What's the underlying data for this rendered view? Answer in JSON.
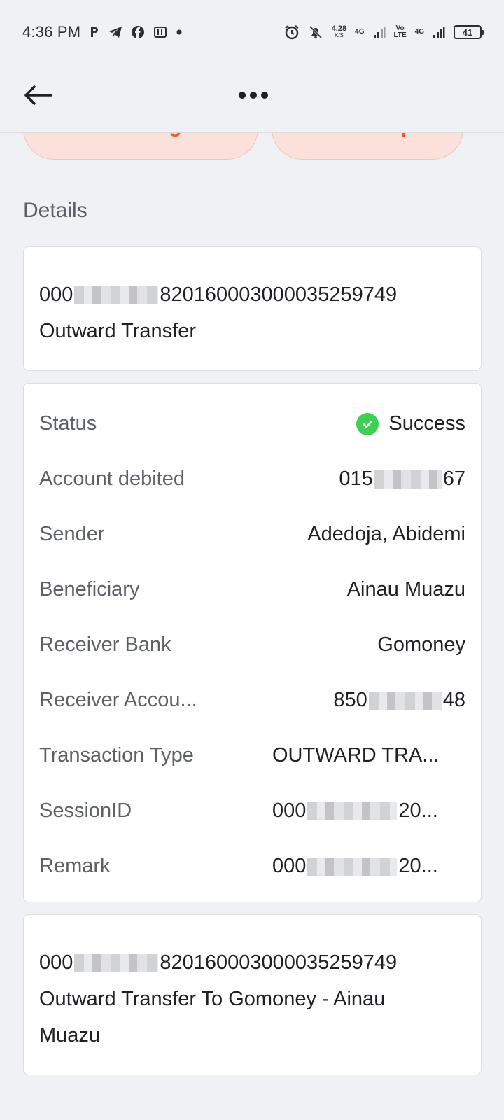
{
  "status_bar": {
    "time": "4:36 PM",
    "speed_value": "4.28",
    "speed_unit": "K/S",
    "net1": "4G",
    "volte_top": "Vo",
    "volte_bottom": "LTE",
    "net2": "4G",
    "battery": "41"
  },
  "app_bar": {
    "back_icon": "arrow-left-icon",
    "more_icon": "more-horizontal-icon"
  },
  "actions": {
    "send_again": "Send again",
    "receipt": "Receipt"
  },
  "section_title": "Details",
  "reference_card": {
    "ref_prefix": "000",
    "ref_suffix": "820160003000035259749",
    "type": "Outward Transfer"
  },
  "details": {
    "rows": [
      {
        "label": "Status",
        "value": "Success"
      },
      {
        "label": "Account debited",
        "value_prefix": "015",
        "value_suffix": "67"
      },
      {
        "label": "Sender",
        "value": "Adedoja, Abidemi"
      },
      {
        "label": "Beneficiary",
        "value": "Ainau Muazu"
      },
      {
        "label": "Receiver Bank",
        "value": "Gomoney"
      },
      {
        "label": "Receiver Accou...",
        "value_prefix": "850",
        "value_suffix": "48"
      },
      {
        "label": "Transaction Type",
        "value": "OUTWARD TRA..."
      },
      {
        "label": "SessionID",
        "value_prefix": "000",
        "value_suffix": "20..."
      },
      {
        "label": "Remark",
        "value_prefix": "000",
        "value_suffix": "20..."
      }
    ],
    "status_color": "#3ecf55"
  },
  "note_card": {
    "ref_prefix": "000",
    "ref_suffix": "820160003000035259749",
    "line2": "Outward Transfer To Gomoney - Ainau",
    "line3": "Muazu"
  },
  "colors": {
    "accent": "#f05a2e",
    "pill_bg": "#fbe1da",
    "background": "#f0f1f5"
  }
}
